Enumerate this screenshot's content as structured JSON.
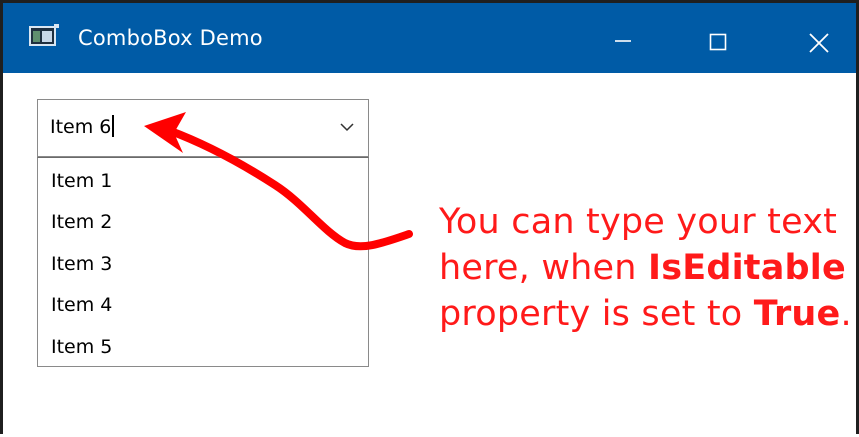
{
  "window": {
    "title": "ComboBox Demo"
  },
  "combobox": {
    "value": "Item 6",
    "items": [
      "Item 1",
      "Item 2",
      "Item 3",
      "Item 4",
      "Item 5"
    ]
  },
  "annotation": {
    "line1": "You can type your text",
    "line2_prefix": "here, when ",
    "line2_bold": "IsEditable",
    "line3_prefix": "property is set to ",
    "line3_bold": "True",
    "line3_suffix": "."
  },
  "colors": {
    "titlebar": "#005ba6",
    "annotation": "#ff1a1a",
    "arrow": "#ff0000"
  },
  "icons": {
    "app": "window-app-icon",
    "minimize": "minimize-icon",
    "maximize": "maximize-icon",
    "close": "close-icon",
    "dropdown": "chevron-down-icon"
  }
}
